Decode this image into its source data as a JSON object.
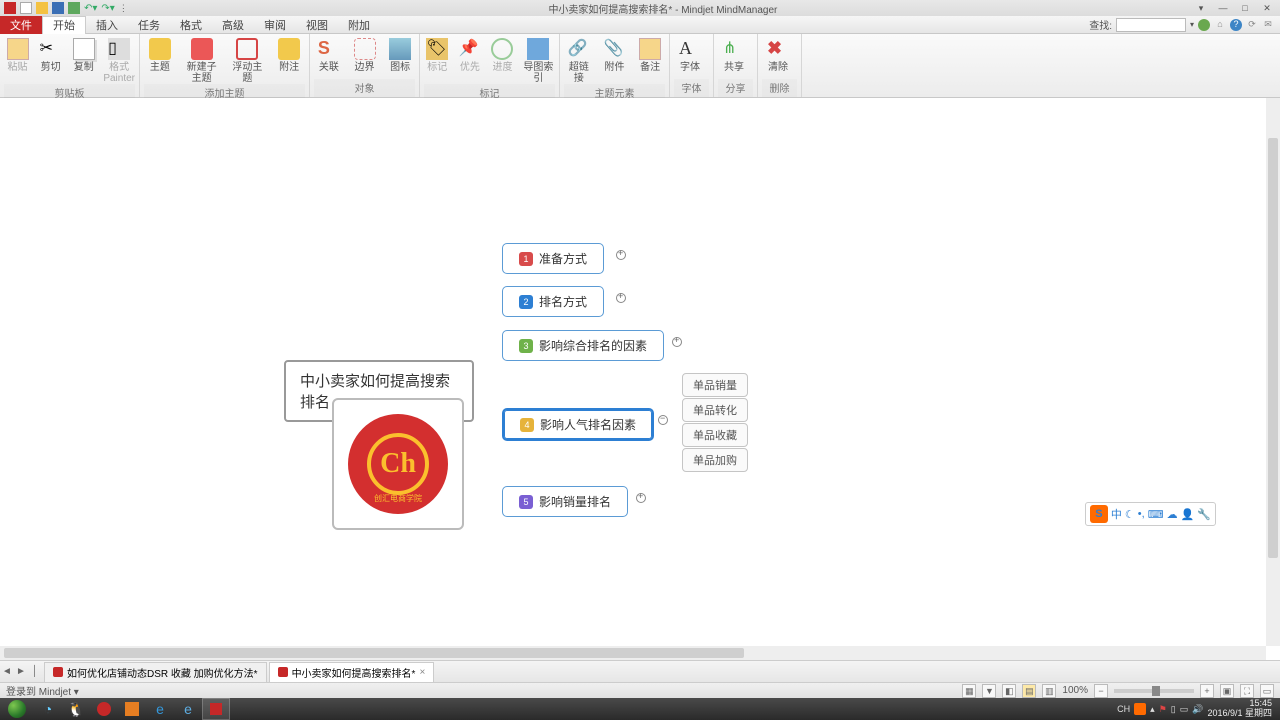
{
  "app": {
    "title": "中小卖家如何提高搜索排名* - Mindjet MindManager",
    "wincontrols": {
      "min": "—",
      "max": "□",
      "close": "✕",
      "help_min": "▾"
    }
  },
  "qat": [
    "M",
    "new",
    "open",
    "save",
    "print",
    "undo",
    "redo",
    "more"
  ],
  "menutabs": {
    "file": "文件",
    "tabs": [
      "开始",
      "插入",
      "任务",
      "格式",
      "高级",
      "审阅",
      "视图",
      "附加"
    ],
    "activeIndex": 0,
    "search_label": "查找:"
  },
  "ribbon": {
    "groups": [
      {
        "label": "剪贴板",
        "items": [
          {
            "name": "paste",
            "label": "粘贴",
            "disabled": true
          },
          {
            "name": "cut",
            "label": "剪切"
          },
          {
            "name": "copy",
            "label": "复制"
          },
          {
            "name": "format-painter",
            "label": "格式\nPainter",
            "disabled": true
          }
        ]
      },
      {
        "label": "添加主题",
        "items": [
          {
            "name": "topic",
            "label": "主题"
          },
          {
            "name": "new-subtopic",
            "label": "新建子主题"
          },
          {
            "name": "floating-topic",
            "label": "浮动主题"
          },
          {
            "name": "callout",
            "label": "附注"
          }
        ]
      },
      {
        "label": "对象",
        "items": [
          {
            "name": "relationship",
            "label": "关联"
          },
          {
            "name": "boundary",
            "label": "边界"
          },
          {
            "name": "image",
            "label": "图标"
          }
        ]
      },
      {
        "label": "标记",
        "items": [
          {
            "name": "tag",
            "label": "标记",
            "disabled": true
          },
          {
            "name": "priority",
            "label": "优先",
            "disabled": true
          },
          {
            "name": "progress",
            "label": "进度",
            "disabled": true
          },
          {
            "name": "map-index",
            "label": "导图索引"
          }
        ]
      },
      {
        "label": "主题元素",
        "items": [
          {
            "name": "hyperlink",
            "label": "超链接"
          },
          {
            "name": "attachment",
            "label": "附件"
          },
          {
            "name": "notes",
            "label": "备注"
          }
        ]
      },
      {
        "label": "字体",
        "items": [
          {
            "name": "font",
            "label": "字体"
          }
        ]
      },
      {
        "label": "分享",
        "items": [
          {
            "name": "share",
            "label": "共享"
          }
        ]
      },
      {
        "label": "删除",
        "items": [
          {
            "name": "clear",
            "label": "清除"
          }
        ]
      }
    ]
  },
  "mindmap": {
    "central": "中小卖家如何提高搜索排名",
    "logo_label": "创汇电商学院",
    "logo_letter": "Ch",
    "branches": [
      {
        "num": "1",
        "color": "#d84b4b",
        "label": "准备方式",
        "expand": true
      },
      {
        "num": "2",
        "color": "#2d7fd3",
        "label": "排名方式",
        "expand": true
      },
      {
        "num": "3",
        "color": "#6fb24a",
        "label": "影响综合排名的因素",
        "expand": true
      },
      {
        "num": "4",
        "color": "#e6b33a",
        "label": "影响人气排名因素",
        "expand": false,
        "selected": true,
        "children": [
          "单品销量",
          "单品转化",
          "单品收藏",
          "单品加购"
        ]
      },
      {
        "num": "5",
        "color": "#7a5fd3",
        "label": "影响销量排名",
        "expand": true
      }
    ]
  },
  "ime": {
    "s": "S",
    "cn": "中"
  },
  "doctabs": {
    "tabs": [
      {
        "label": "如何优化店铺动态DSR 收藏 加购优化方法*"
      },
      {
        "label": "中小卖家如何提高搜索排名*"
      }
    ],
    "activeIndex": 1
  },
  "statusbar": {
    "left": "登录到 Mindjet ▾",
    "zoom": "100%"
  },
  "taskbar": {
    "icons": [
      "start",
      "cloud",
      "qq",
      "rec",
      "box",
      "edge",
      "ie",
      "mm"
    ],
    "tray_cn": "CH",
    "clock_time": "15:45",
    "clock_date": "2016/9/1 星期四"
  }
}
